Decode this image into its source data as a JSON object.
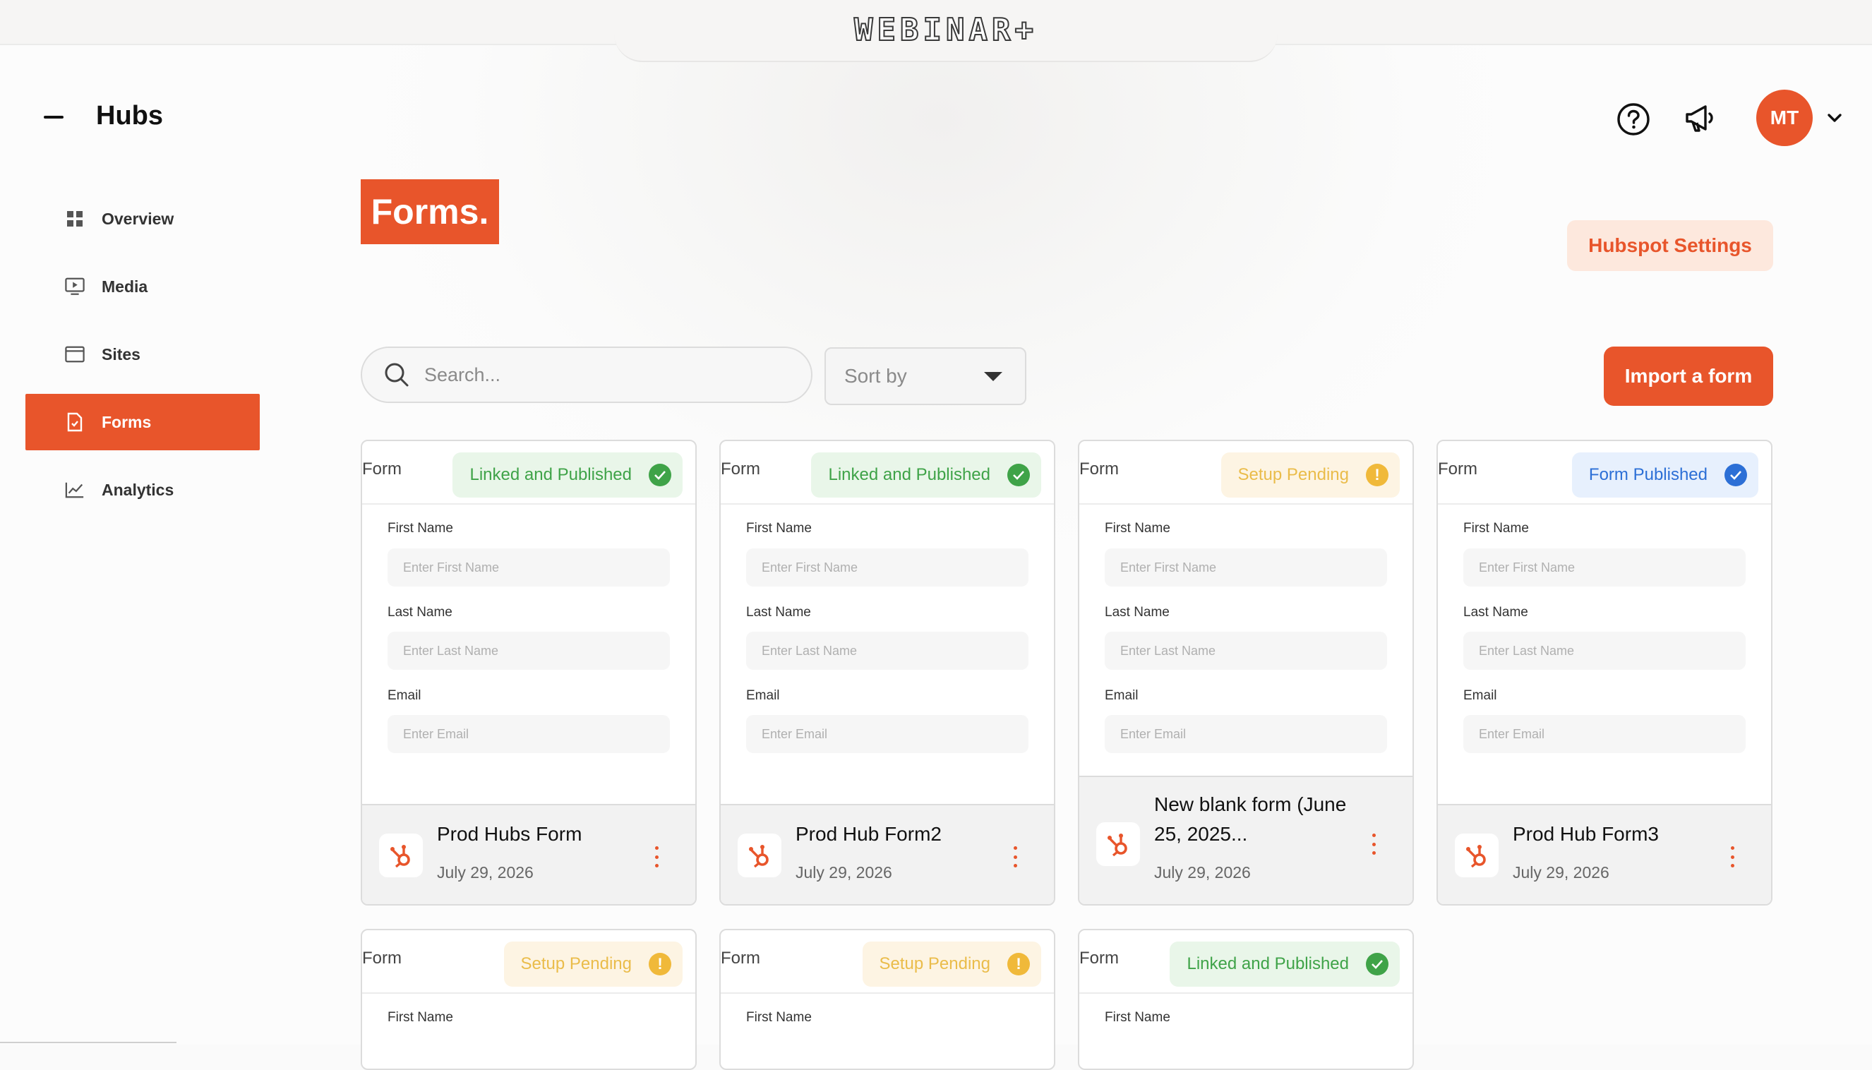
{
  "brand": {
    "logo_text": "WEBINAR+",
    "accent_color": "#e8552b"
  },
  "sidebar": {
    "hub_title": "Hubs",
    "items": [
      {
        "label": "Overview",
        "icon": "grid-icon"
      },
      {
        "label": "Media",
        "icon": "media-icon"
      },
      {
        "label": "Sites",
        "icon": "browser-icon"
      },
      {
        "label": "Forms",
        "icon": "form-doc-icon",
        "active": true
      },
      {
        "label": "Analytics",
        "icon": "chart-line-icon"
      }
    ]
  },
  "header": {
    "avatar_initials": "MT"
  },
  "main": {
    "title": "Forms.",
    "hubspot_settings_label": "Hubspot Settings",
    "search_placeholder": "Search...",
    "sort_label": "Sort by",
    "import_label": "Import a form"
  },
  "form_preview": {
    "tag": "Form",
    "first_name_label": "First Name",
    "first_name_placeholder": "Enter First Name",
    "last_name_label": "Last Name",
    "last_name_placeholder": "Enter Last Name",
    "email_label": "Email",
    "email_placeholder": "Enter Email"
  },
  "cards": [
    {
      "status": "Linked and Published",
      "status_type": "green",
      "name": "Prod Hubs Form",
      "date": "July 29, 2026"
    },
    {
      "status": "Linked and Published",
      "status_type": "green",
      "name": "Prod Hub Form2",
      "date": "July 29, 2026"
    },
    {
      "status": "Setup Pending",
      "status_type": "yellow",
      "name": "New blank form (June 25, 2025...",
      "date": "July 29, 2026"
    },
    {
      "status": "Form Published",
      "status_type": "blue",
      "name": "Prod Hub Form3",
      "date": "July 29, 2026"
    },
    {
      "status": "Setup Pending",
      "status_type": "yellow"
    },
    {
      "status": "Setup Pending",
      "status_type": "yellow"
    },
    {
      "status": "Linked and Published",
      "status_type": "green"
    }
  ]
}
